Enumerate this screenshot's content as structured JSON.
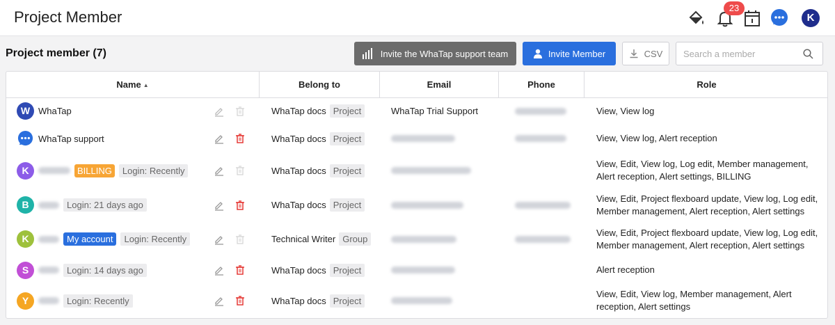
{
  "header": {
    "title": "Project Member",
    "notification_count": "23",
    "user_initial": "K"
  },
  "section": {
    "title": "Project member (7)"
  },
  "toolbar": {
    "support_label": "Invite the WhaTap support team",
    "invite_label": "Invite Member",
    "csv_label": "CSV",
    "search_placeholder": "Search a member"
  },
  "table": {
    "columns": [
      "Name",
      "Belong to",
      "Email",
      "Phone",
      "Role"
    ],
    "sort_indicator": "▲",
    "rows": [
      {
        "initial": "W",
        "avatar_color": "#2f4ab4",
        "name": "WhaTap",
        "belong": "WhaTap docs",
        "belong_type": "Project",
        "email": "WhaTap Trial Support",
        "role": "View, View log",
        "deletable": false
      },
      {
        "initial": "",
        "avatar_color": "#2a6fde",
        "name": "WhaTap support",
        "belong": "WhaTap docs",
        "belong_type": "Project",
        "role": "View, View log, Alert reception",
        "deletable": true
      },
      {
        "initial": "K",
        "avatar_color": "#8c5ce8",
        "badge": "BILLING",
        "login": "Login: Recently",
        "belong": "WhaTap docs",
        "belong_type": "Project",
        "role": "View, Edit, View log, Log edit, Member management, Alert reception, Alert settings, BILLING",
        "deletable": false
      },
      {
        "initial": "B",
        "avatar_color": "#1fb3a8",
        "login": "Login: 21 days ago",
        "belong": "WhaTap docs",
        "belong_type": "Project",
        "role": "View, Edit, Project flexboard update, View log, Log edit, Member management, Alert reception, Alert settings",
        "deletable": true
      },
      {
        "initial": "K",
        "avatar_color": "#9ec13c",
        "badge": "My account",
        "login": "Login: Recently",
        "belong": "Technical Writer",
        "belong_type": "Group",
        "role": "View, Edit, Project flexboard update, View log, Log edit, Member management, Alert reception, Alert settings",
        "deletable": false
      },
      {
        "initial": "S",
        "avatar_color": "#c14fd6",
        "login": "Login: 14 days ago",
        "belong": "WhaTap docs",
        "belong_type": "Project",
        "role": "Alert reception",
        "deletable": true
      },
      {
        "initial": "Y",
        "avatar_color": "#f5a623",
        "login": "Login: Recently",
        "belong": "WhaTap docs",
        "belong_type": "Project",
        "role": "View, Edit, View log, Member management, Alert reception, Alert settings",
        "deletable": true
      }
    ]
  },
  "icons": [
    "paint-bucket-icon",
    "bell-icon",
    "calendar-icon",
    "chat-icon",
    "bar-chart-icon",
    "user-icon",
    "download-icon",
    "search-icon",
    "pencil-icon",
    "trash-icon"
  ]
}
